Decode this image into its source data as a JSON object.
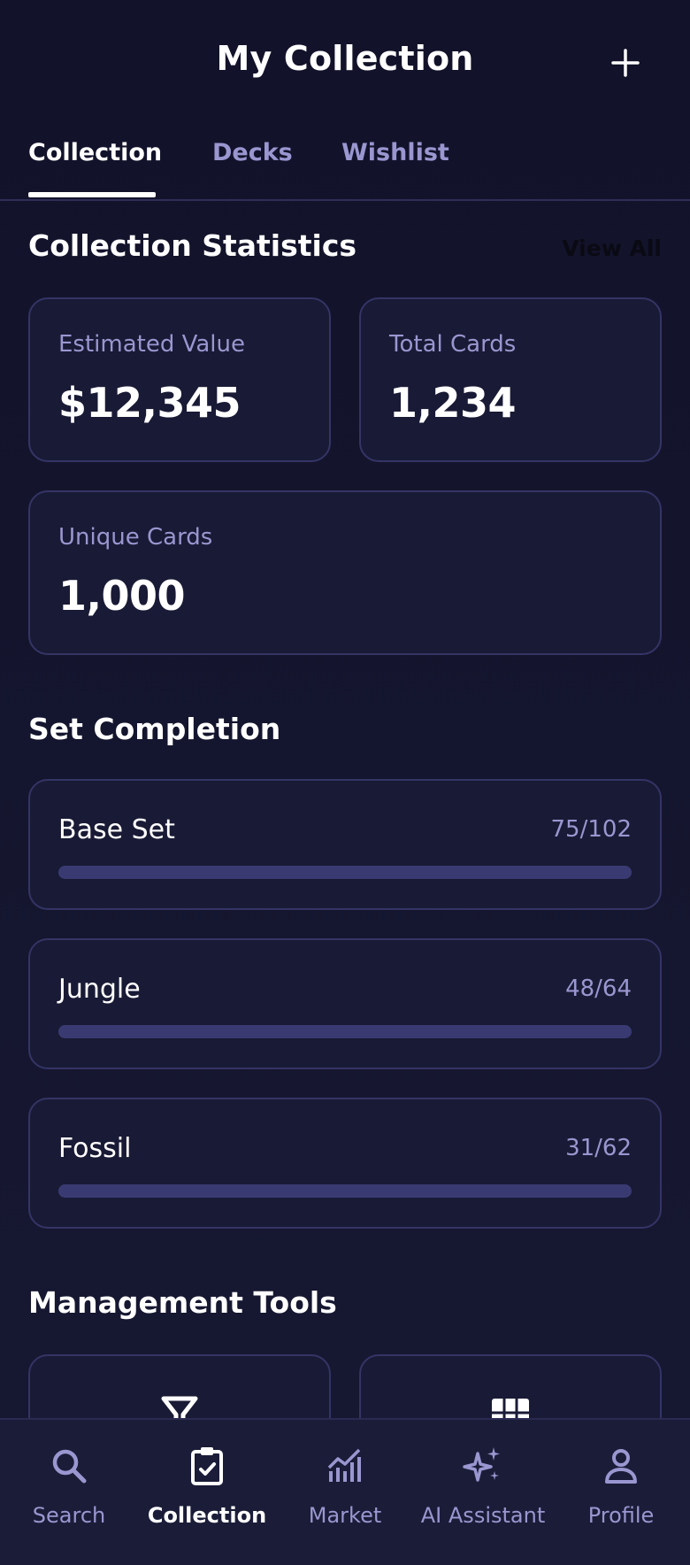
{
  "header": {
    "title": "My Collection",
    "add_icon": "plus-icon"
  },
  "tabs": [
    {
      "label": "Collection",
      "active": true
    },
    {
      "label": "Decks",
      "active": false
    },
    {
      "label": "Wishlist",
      "active": false
    }
  ],
  "statistics": {
    "title": "Collection Statistics",
    "view_all": "View All",
    "cards": [
      {
        "label": "Estimated Value",
        "value": "$12,345"
      },
      {
        "label": "Total Cards",
        "value": "1,234"
      },
      {
        "label": "Unique Cards",
        "value": "1,000"
      }
    ]
  },
  "set_completion": {
    "title": "Set Completion",
    "sets": [
      {
        "name": "Base Set",
        "count": "75/102",
        "progress": 0.735
      },
      {
        "name": "Jungle",
        "count": "48/64",
        "progress": 0.75
      },
      {
        "name": "Fossil",
        "count": "31/62",
        "progress": 0.5
      }
    ]
  },
  "management_tools": {
    "title": "Management Tools",
    "tools": [
      {
        "icon": "filter-icon"
      },
      {
        "icon": "grid-icon"
      }
    ]
  },
  "bottom_nav": [
    {
      "label": "Search",
      "icon": "search-icon",
      "active": false
    },
    {
      "label": "Collection",
      "icon": "clipboard-check-icon",
      "active": true
    },
    {
      "label": "Market",
      "icon": "chart-icon",
      "active": false
    },
    {
      "label": "AI Assistant",
      "icon": "sparkles-icon",
      "active": false
    },
    {
      "label": "Profile",
      "icon": "person-icon",
      "active": false
    }
  ],
  "colors": {
    "background": "#13132a",
    "card_border": "#343466",
    "muted_text": "#9a96d0",
    "progress_track": "#3a3a72"
  }
}
